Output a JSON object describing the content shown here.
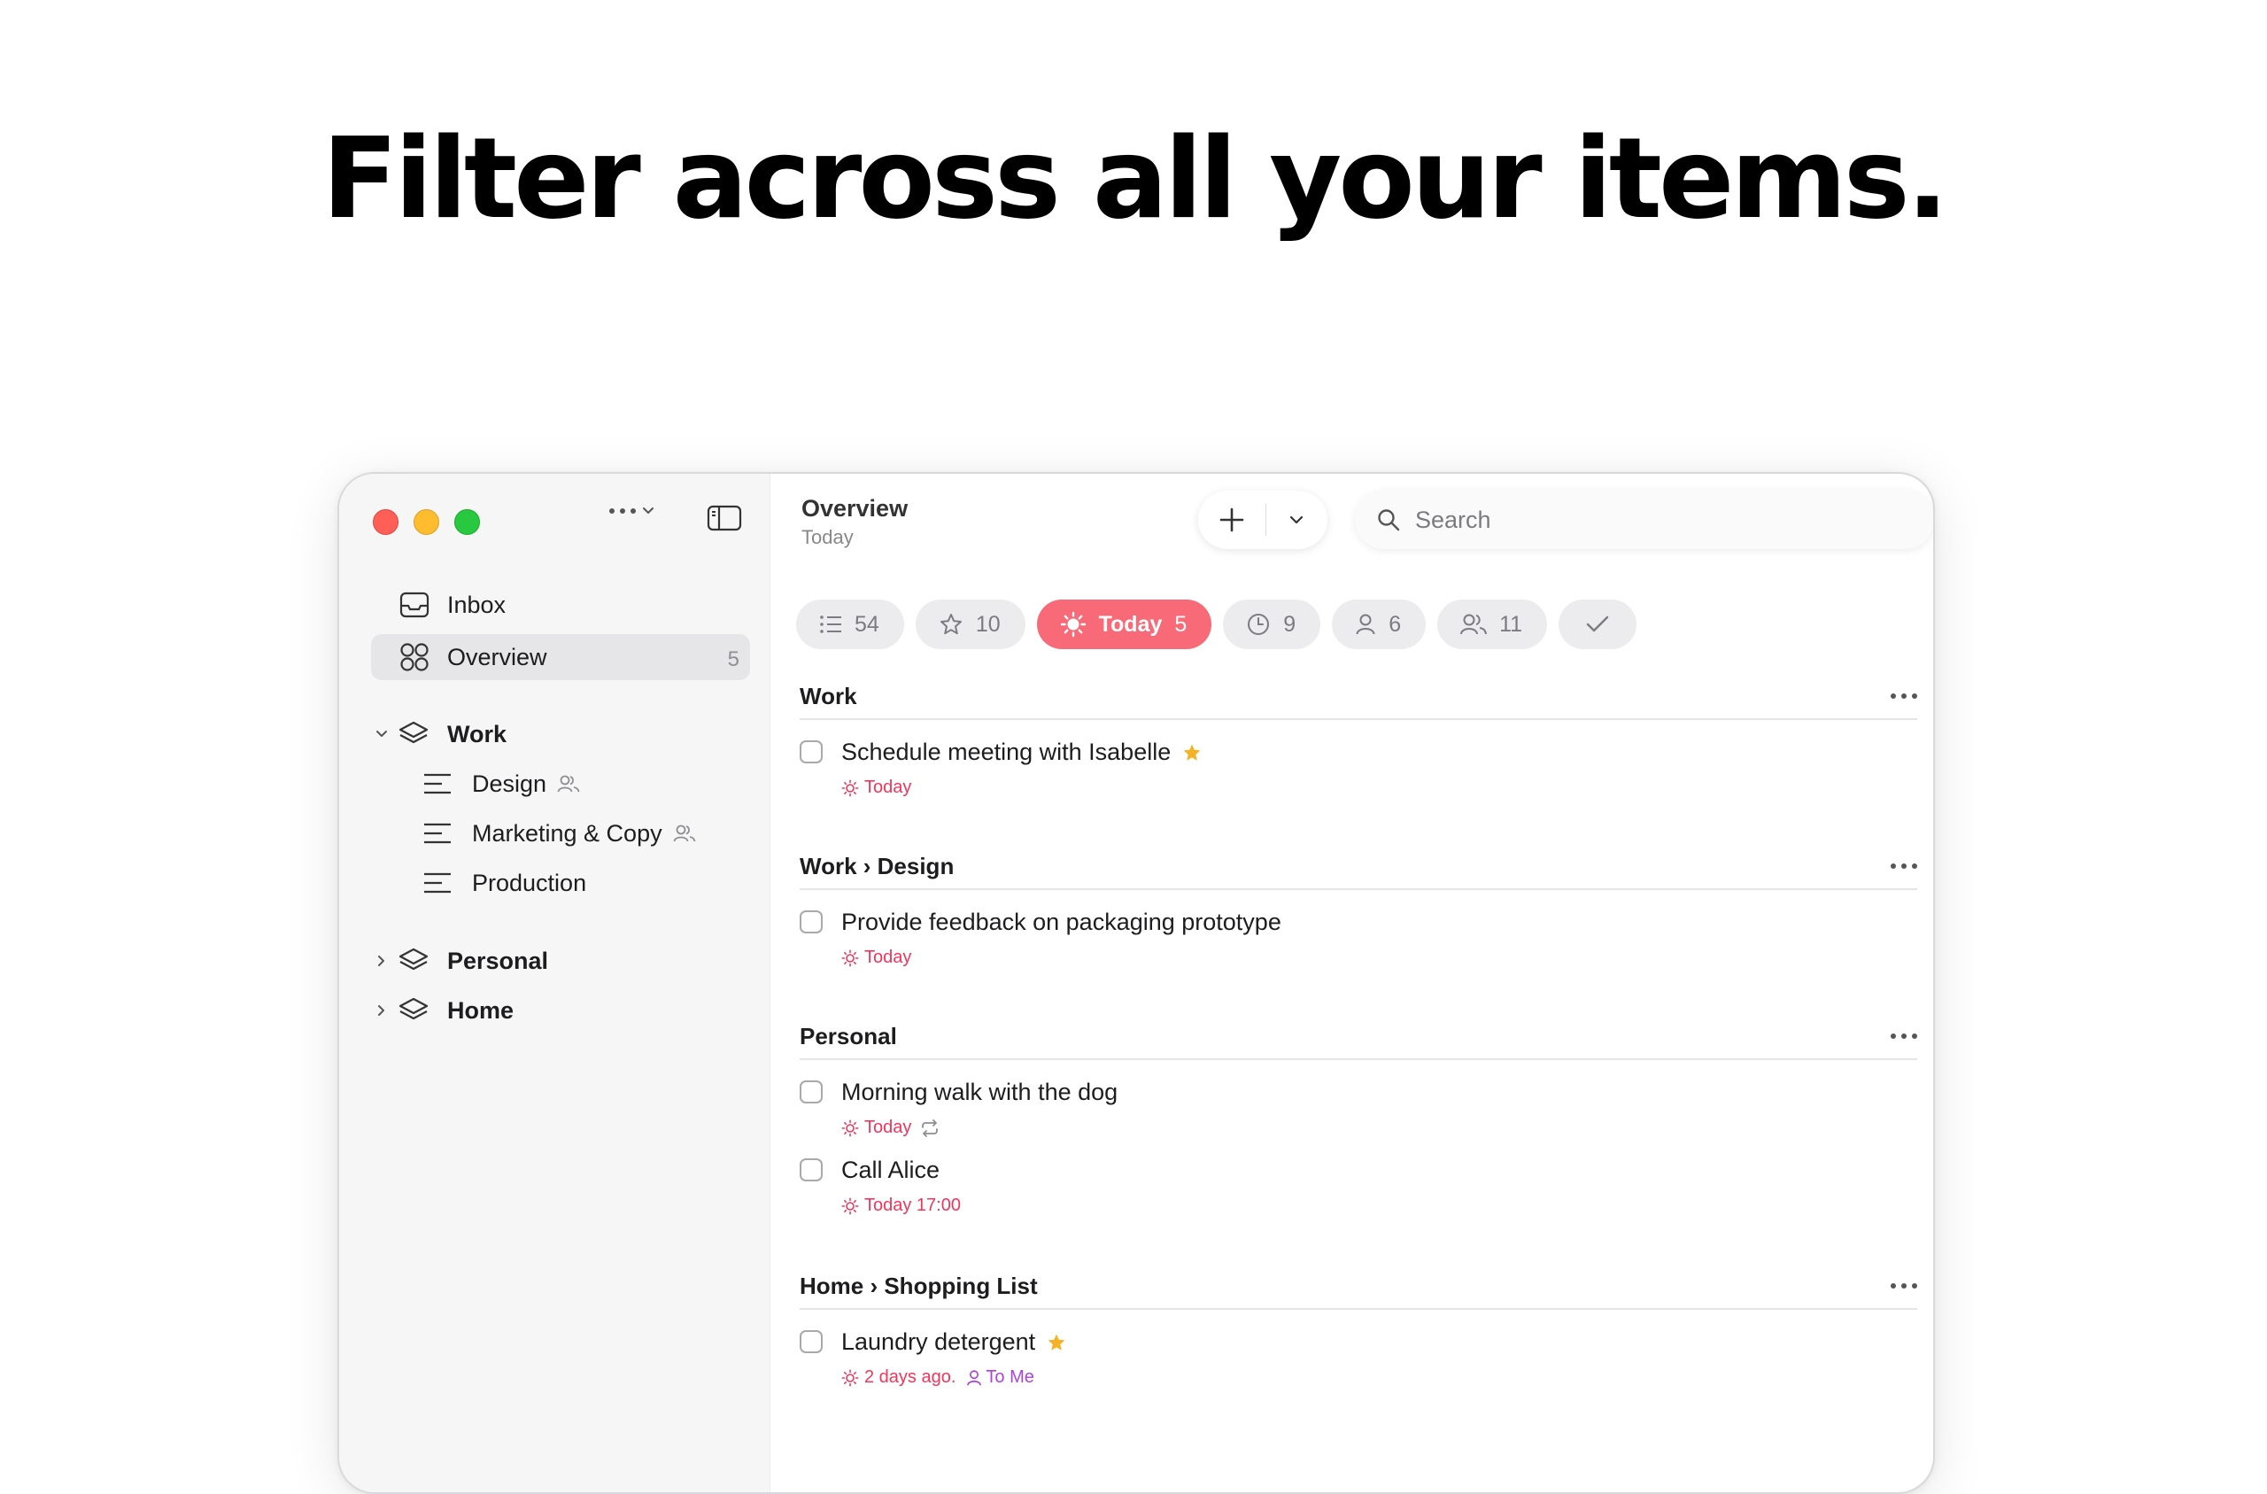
{
  "headline": "Filter across all your items.",
  "sidebar": {
    "inbox": "Inbox",
    "overview": "Overview",
    "overview_count": "5",
    "work": "Work",
    "design": "Design",
    "marketing": "Marketing & Copy",
    "production": "Production",
    "personal": "Personal",
    "home": "Home"
  },
  "header": {
    "title": "Overview",
    "subtitle": "Today",
    "search_placeholder": "Search"
  },
  "filters": {
    "all": "54",
    "starred": "10",
    "today_label": "Today",
    "today_count": "5",
    "scheduled": "9",
    "assigned_me": "6",
    "shared": "11"
  },
  "sections": [
    {
      "title": "Work",
      "tasks": [
        {
          "title": "Schedule meeting with Isabelle",
          "meta": "Today"
        }
      ]
    },
    {
      "title": "Work › Design",
      "tasks": [
        {
          "title": "Provide feedback on packaging prototype",
          "meta": "Today"
        }
      ]
    },
    {
      "title": "Personal",
      "tasks": [
        {
          "title": "Morning walk with the dog",
          "meta": "Today"
        },
        {
          "title": "Call Alice",
          "meta": "Today 17:00"
        }
      ]
    },
    {
      "title": "Home › Shopping List",
      "tasks": [
        {
          "title": "Laundry detergent",
          "meta": "2 days ago.",
          "assignee": "To Me"
        }
      ]
    }
  ],
  "colors": {
    "accent_today": "#f86a77",
    "due_red": "#f5345a",
    "assignee_purple": "#b041d8",
    "star": "#f5b226"
  },
  "icons": [
    "inbox-icon",
    "overview-icon",
    "layers-icon",
    "list-icon",
    "shared-icon",
    "plus-icon",
    "chevron-down-icon",
    "search-icon",
    "sun-icon",
    "star-icon",
    "clock-icon",
    "person-icon",
    "people-icon",
    "checkmark-icon",
    "repeat-icon",
    "more-icon",
    "sidebar-toggle-icon"
  ]
}
